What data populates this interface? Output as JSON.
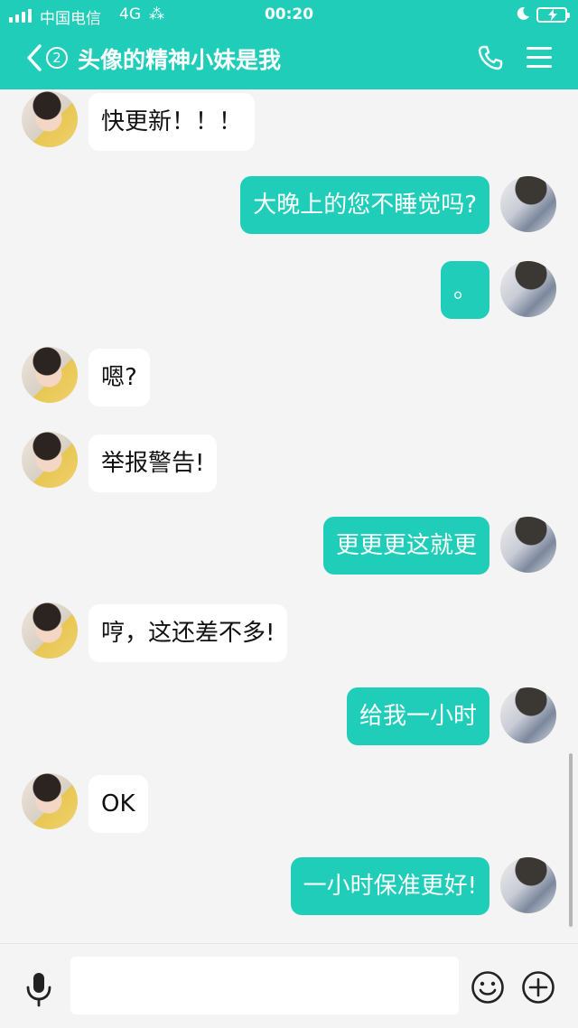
{
  "status_bar": {
    "carrier": "中国电信",
    "network": "4G",
    "loading_glyph": "⁂",
    "time": "00:20"
  },
  "header": {
    "back_badge": "②",
    "title": "头像的精神小妹是我",
    "icons": [
      "back-chevron-icon",
      "phone-icon",
      "menu-icon"
    ]
  },
  "messages": [
    {
      "side": "in",
      "text": "快更新！！！"
    },
    {
      "side": "out",
      "text": "大晚上的您不睡觉吗?"
    },
    {
      "side": "out",
      "text": "。"
    },
    {
      "side": "in",
      "text": "嗯?"
    },
    {
      "side": "in",
      "text": "举报警告!"
    },
    {
      "side": "out",
      "text": "更更更这就更"
    },
    {
      "side": "in",
      "text": "哼，这还差不多!"
    },
    {
      "side": "out",
      "text": "给我一小时"
    },
    {
      "side": "in",
      "text": "OK"
    },
    {
      "side": "out",
      "text": "一小时保准更好!"
    }
  ],
  "input_bar": {
    "placeholder": "",
    "icons": [
      "microphone-icon",
      "emoji-icon",
      "plus-icon"
    ]
  },
  "colors": {
    "accent": "#20cdb9",
    "background": "#f4f4f4",
    "incoming_bubble": "#ffffff"
  }
}
